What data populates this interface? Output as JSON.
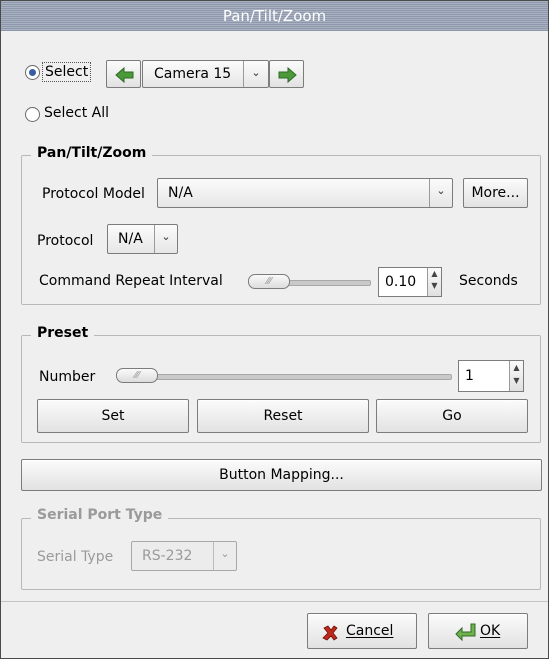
{
  "window": {
    "title": "Pan/Tilt/Zoom"
  },
  "camera": {
    "select_label": "Select",
    "select_all_label": "Select All",
    "selected_camera": "Camera 15"
  },
  "ptz": {
    "group_label": "Pan/Tilt/Zoom",
    "protocol_model_label": "Protocol Model",
    "protocol_model_value": "N/A",
    "more_button": "More...",
    "protocol_label": "Protocol",
    "protocol_value": "N/A",
    "repeat_label": "Command Repeat Interval",
    "repeat_value": "0.10",
    "seconds_label": "Seconds",
    "repeat_slider_level": 0.0
  },
  "preset": {
    "group_label": "Preset",
    "number_label": "Number",
    "number_value": "1",
    "number_slider_level": 0.0,
    "set_button": "Set",
    "reset_button": "Reset",
    "go_button": "Go"
  },
  "button_mapping_label": "Button Mapping...",
  "serial": {
    "group_label": "Serial Port Type",
    "serial_type_label": "Serial Type",
    "serial_type_value": "RS-232"
  },
  "footer": {
    "cancel_label": "Cancel",
    "ok_label": "OK"
  },
  "colors": {
    "title_bar": "#9aa4b6",
    "arrow_green": "#4a9a3a",
    "radio_dot": "#3a5fa0"
  }
}
